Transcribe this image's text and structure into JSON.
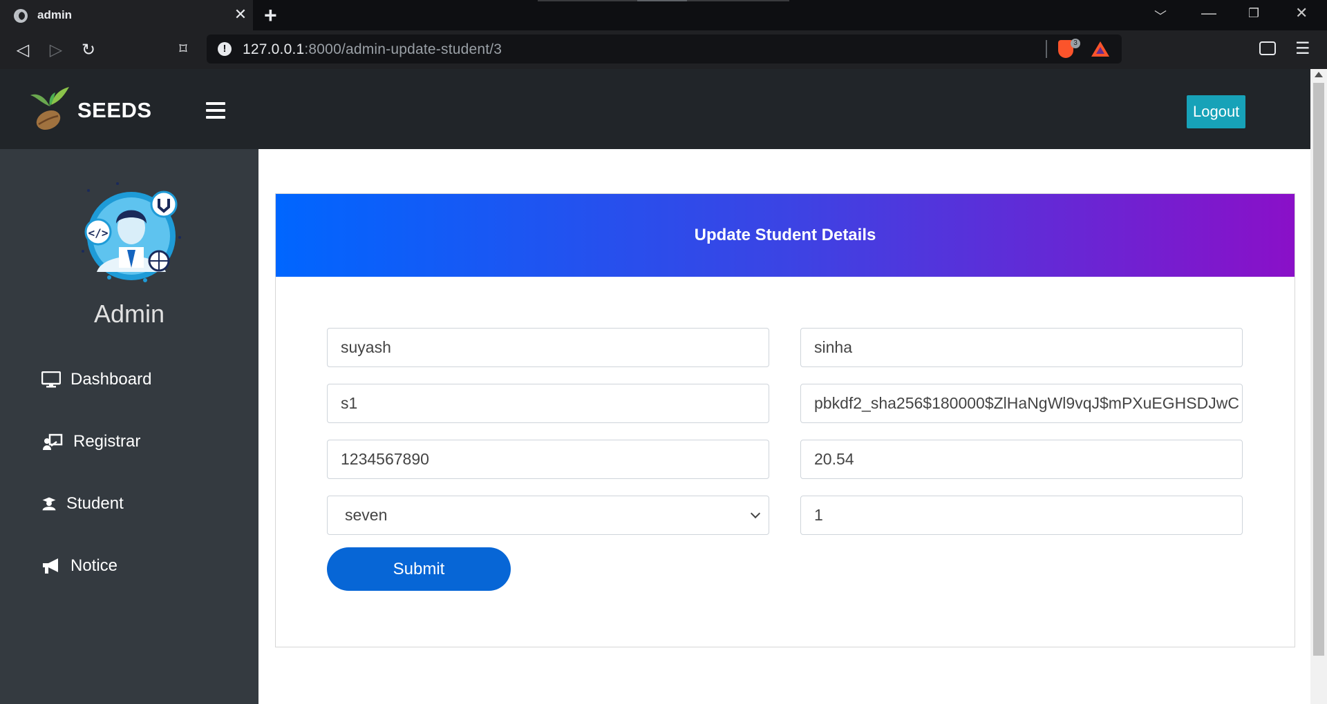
{
  "browser": {
    "tab_title": "admin",
    "tab_close": "✕",
    "new_tab": "+",
    "url_host": "127.0.0.1",
    "url_rest": ":8000/admin-update-student/3",
    "shield_count": "3"
  },
  "site": {
    "brand": "SEEDS",
    "logout_label": "Logout",
    "role": "Admin"
  },
  "sidebar": {
    "items": [
      {
        "label": "Dashboard",
        "icon": "monitor-icon"
      },
      {
        "label": "Registrar",
        "icon": "presenter-icon"
      },
      {
        "label": "Student",
        "icon": "graduate-icon"
      },
      {
        "label": "Notice",
        "icon": "megaphone-icon"
      }
    ]
  },
  "form": {
    "title": "Update Student Details",
    "first_name": "suyash",
    "last_name": "sinha",
    "username": "s1",
    "password": "pbkdf2_sha256$180000$ZlHaNgWl9vqJ$mPXuEGHSDJwC",
    "phone": "1234567890",
    "fee": "20.54",
    "class_selected": "seven",
    "roll": "1",
    "submit_label": "Submit"
  },
  "colors": {
    "navbar": "#212529",
    "sidebar": "#343a40",
    "logout": "#17a2b8",
    "submit": "#0766d6",
    "header_gradient_start": "#0066ff",
    "header_gradient_end": "#8a10c8"
  }
}
